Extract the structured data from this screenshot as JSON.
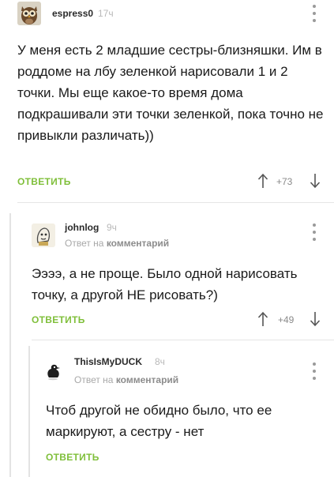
{
  "comments": [
    {
      "username": "espress0",
      "time": "17ч",
      "text": "У меня есть 2 младшие сестры-близняшки. Им в роддоме на лбу зеленкой нарисовали 1 и 2 точки. Мы еще какое-то время дома подкрашивали эти точки зеленкой, пока точно не привыкли различать))",
      "reply_label": "ОТВЕТИТЬ",
      "rating": "+73",
      "avatar_icon": "owl-avatar-icon"
    },
    {
      "username": "johnlog",
      "time": "9ч",
      "reply_prefix": "Ответ на",
      "reply_target": "комментарий",
      "text": "Ээээ, а не проще. Было одной нарисовать точку, а другой НЕ рисовать?)",
      "reply_label": "ОТВЕТИТЬ",
      "rating": "+49",
      "avatar_icon": "sketch-avatar-icon"
    },
    {
      "username": "ThisIsMyDUCK",
      "time": "8ч",
      "reply_prefix": "Ответ на",
      "reply_target": "комментарий",
      "text": "Чтоб другой не обидно было, что ее маркируют, а сестру - нет",
      "reply_label": "ОТВЕТИТЬ",
      "avatar_icon": "duck-avatar-icon"
    }
  ],
  "colors": {
    "accent_green": "#7fbf3a",
    "muted_text": "#a8a8a8",
    "thread_line": "#e3e3e3"
  }
}
